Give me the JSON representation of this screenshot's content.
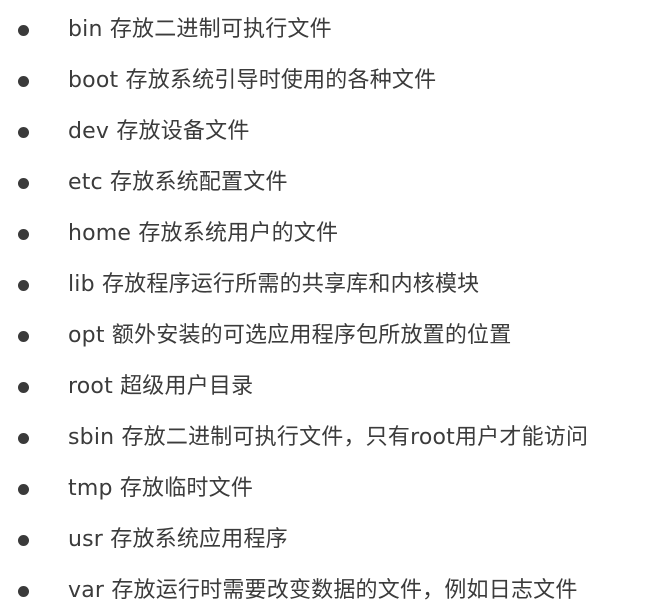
{
  "items": [
    {
      "label": "bin 存放二进制可执行文件"
    },
    {
      "label": "boot 存放系统引导时使用的各种文件"
    },
    {
      "label": "dev 存放设备文件"
    },
    {
      "label": "etc 存放系统配置文件"
    },
    {
      "label": "home 存放系统用户的文件"
    },
    {
      "label": "lib 存放程序运行所需的共享库和内核模块"
    },
    {
      "label": "opt 额外安装的可选应用程序包所放置的位置"
    },
    {
      "label": "root 超级用户目录"
    },
    {
      "label": "sbin 存放二进制可执行文件，只有root用户才能访问"
    },
    {
      "label": "tmp 存放临时文件"
    },
    {
      "label": "usr 存放系统应用程序"
    },
    {
      "label": "var 存放运行时需要改变数据的文件，例如日志文件"
    }
  ]
}
